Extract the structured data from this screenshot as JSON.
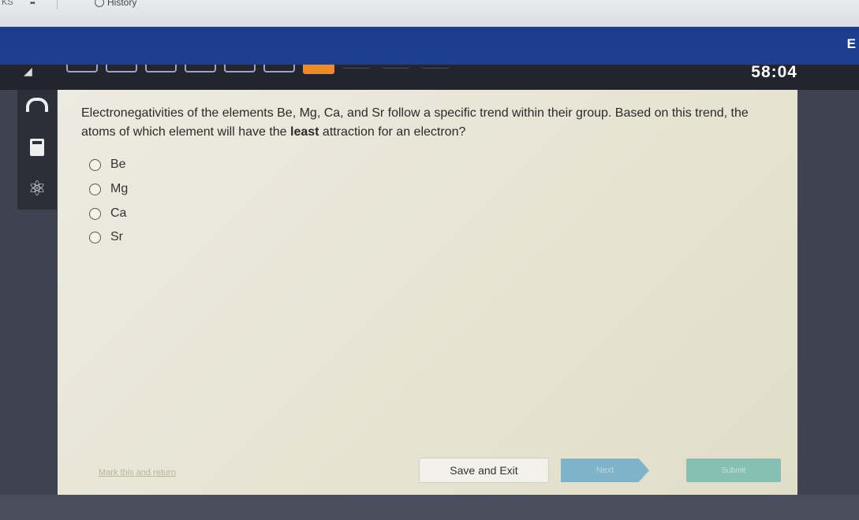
{
  "browser": {
    "left_text": "KS",
    "history_label": "History"
  },
  "header": {
    "corner_text": "E"
  },
  "progress": {
    "steps": 10,
    "current_step": 7,
    "timer": "58:04"
  },
  "question": {
    "text_before": "Electronegativities of the elements Be, Mg, Ca, and Sr follow a specific trend within their group. Based on this trend, the atoms of which element will have the ",
    "emphasis": "least",
    "text_after": " attraction for an electron?"
  },
  "choices": [
    {
      "label": "Be"
    },
    {
      "label": "Mg"
    },
    {
      "label": "Ca"
    },
    {
      "label": "Sr"
    }
  ],
  "footer": {
    "mark_link": "Mark this and return",
    "save_exit": "Save and Exit",
    "next": "Next",
    "submit": "Submit"
  },
  "colors": {
    "header_blue": "#1c3c8c",
    "current_step": "#f08a24",
    "next_button": "#7fb3c7",
    "submit_button": "#86c0b3"
  }
}
